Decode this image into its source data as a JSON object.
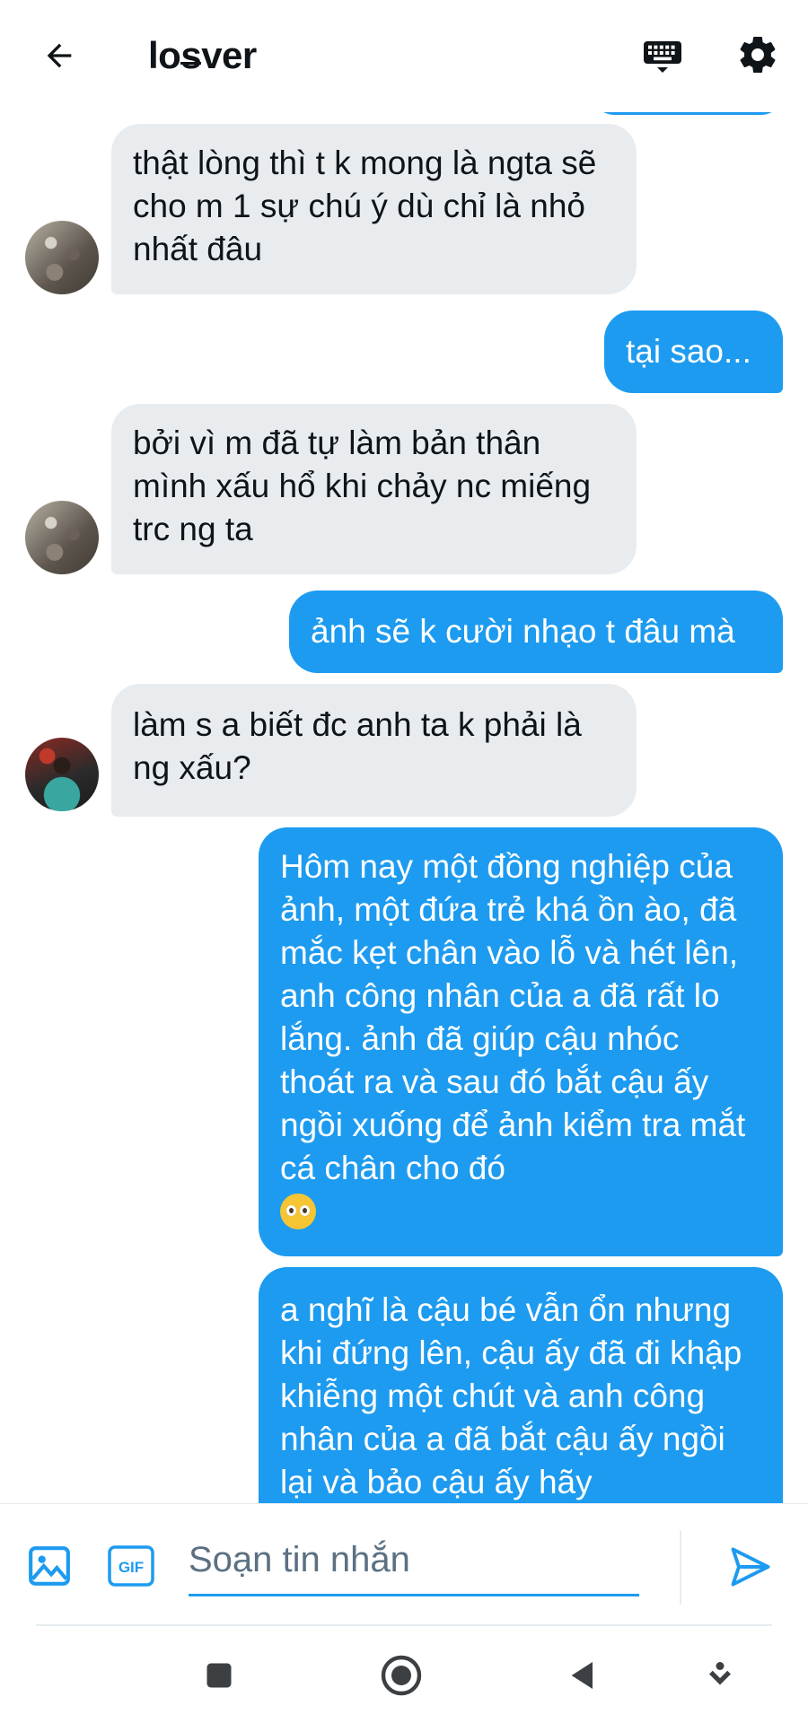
{
  "header": {
    "title_pre": "lo",
    "title_strike": "s",
    "title_post": "ver",
    "icons": [
      "back-arrow-icon",
      "keyboard-icon",
      "gear-icon"
    ]
  },
  "messages": [
    {
      "from": "them",
      "text": "thật lòng thì t k mong là ngta sẽ cho m 1 sự chú ý dù chỉ là nhỏ nhất đâu"
    },
    {
      "from": "me",
      "text": "tại sao..."
    },
    {
      "from": "them",
      "text": "bởi vì m đã tự làm bản thân mình xấu hổ khi chảy nc miếng trc ng ta"
    },
    {
      "from": "me",
      "text": "ảnh sẽ k cười nhạo t đâu mà"
    },
    {
      "from": "them",
      "text": "làm s a biết đc anh ta k phải là ng xấu?"
    },
    {
      "from": "me",
      "text": "Hôm nay một đồng nghiệp của ảnh, một đứa trẻ khá ồn ào, đã mắc kẹt chân vào lỗ và hét lên, anh công nhân của a đã rất lo lắng. ảnh đã giúp cậu nhóc thoát ra và sau đó bắt cậu ấy ngồi xuống để ảnh kiểm tra mắt cá chân cho đó",
      "emoji": "pleading-face"
    },
    {
      "from": "me",
      "text": "a nghĩ là cậu bé vẫn ổn nhưng khi đứng lên, cậu ấy đã đi khập khiễng một chút và anh công nhân của a đã bắt cậu ấy ngồi lại và bảo cậu ấy hãy"
    }
  ],
  "composer": {
    "placeholder": "Soạn tin nhắn",
    "gif_label": "GIF"
  },
  "colors": {
    "accent": "#1d9bf0",
    "received_bubble": "#e9ecef",
    "text": "#0f1419",
    "muted": "#5b7083"
  },
  "navbar": {
    "icons": [
      "recents-square-icon",
      "home-circle-icon",
      "back-triangle-icon",
      "notification-pull-icon"
    ]
  }
}
